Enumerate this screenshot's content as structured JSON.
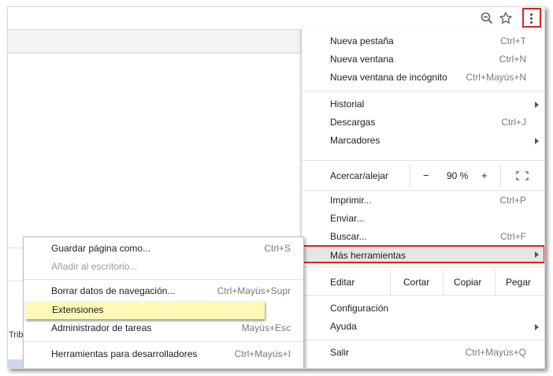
{
  "toolbar": {
    "icons": [
      "zoom-out-icon",
      "star-icon",
      "kebab-menu-icon"
    ]
  },
  "page": {
    "partial_text": "Trib"
  },
  "main_menu": {
    "new_tab": {
      "label": "Nueva pestaña",
      "shortcut": "Ctrl+T"
    },
    "new_window": {
      "label": "Nueva ventana",
      "shortcut": "Ctrl+N"
    },
    "incognito": {
      "label": "Nueva ventana de incógnito",
      "shortcut": "Ctrl+Mayús+N"
    },
    "history": {
      "label": "Historial"
    },
    "downloads": {
      "label": "Descargas",
      "shortcut": "Ctrl+J"
    },
    "bookmarks": {
      "label": "Marcadores"
    },
    "zoom": {
      "label": "Acercar/alejar",
      "minus": "−",
      "value": "90 %",
      "plus": "+"
    },
    "print": {
      "label": "Imprimir...",
      "shortcut": "Ctrl+P"
    },
    "cast": {
      "label": "Enviar..."
    },
    "find": {
      "label": "Buscar...",
      "shortcut": "Ctrl+F"
    },
    "more_tools": {
      "label": "Más herramientas"
    },
    "edit": {
      "label": "Editar",
      "cut": "Cortar",
      "copy": "Copiar",
      "paste": "Pegar"
    },
    "settings": {
      "label": "Configuración"
    },
    "help": {
      "label": "Ayuda"
    },
    "exit": {
      "label": "Salir",
      "shortcut": "Ctrl+Mayús+Q"
    }
  },
  "sub_menu": {
    "save_page": {
      "label": "Guardar página como...",
      "shortcut": "Ctrl+S"
    },
    "add_desktop": {
      "label": "Añadir al escritorio..."
    },
    "clear_data": {
      "label": "Borrar datos de navegación...",
      "shortcut": "Ctrl+Mayús+Supr"
    },
    "extensions": {
      "label": "Extensiones"
    },
    "task_manager": {
      "label": "Administrador de tareas",
      "shortcut": "Mayús+Esc"
    },
    "dev_tools": {
      "label": "Herramientas para desarrolladores",
      "shortcut": "Ctrl+Mayús+I"
    }
  },
  "colors": {
    "highlight_border": "#e02020",
    "selected_item": "#fff9b8"
  }
}
